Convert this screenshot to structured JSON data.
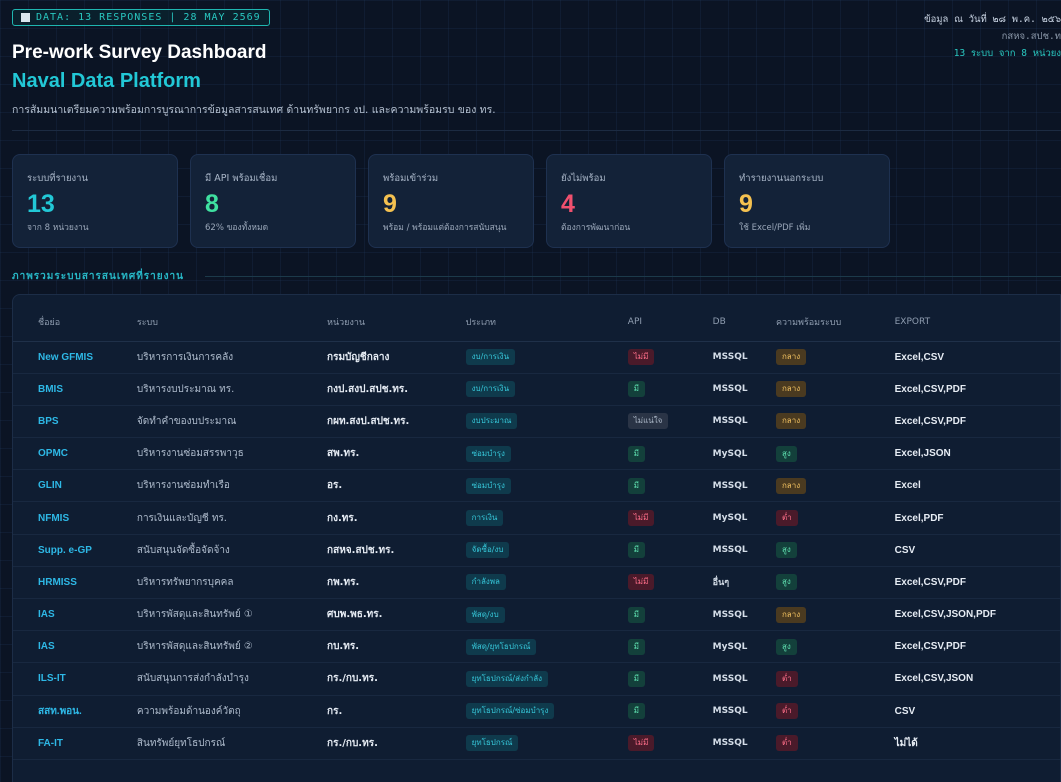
{
  "header": {
    "badge": "DATA: 13 RESPONSES | 28 MAY 2569",
    "title": "Pre-work Survey Dashboard",
    "subtitle_brand": "Naval Data Platform",
    "description": "การสัมมนาเตรียมความพร้อมการบูรณาการข้อมูลสารสนเทศ ด้านทรัพยากร งป. และความพร้อมรบ ของ ทร.",
    "right_line1": "ข้อมูล ณ วันที่ ๒๘ พ.ค. ๒๕๖",
    "right_line2": "กสหจ.สปช.ท",
    "right_line3": "13 ระบบ จาก 8 หน่วยง"
  },
  "cards": [
    {
      "label": "ระบบที่รายงาน",
      "value": "13",
      "sub": "จาก 8 หน่วยงาน",
      "color": "#22c8d6"
    },
    {
      "label": "มี API พร้อมเชื่อม",
      "value": "8",
      "sub": "62% ของทั้งหมด",
      "color": "#3fe0a0"
    },
    {
      "label": "พร้อมเข้าร่วม",
      "value": "9",
      "sub": "พร้อม / พร้อมแต่ต้องการสนับสนุน",
      "color": "#f4c150"
    },
    {
      "label": "ยังไม่พร้อม",
      "value": "4",
      "sub": "ต้องการพัฒนาก่อน",
      "color": "#f0506e"
    },
    {
      "label": "ทำรายงานนอกระบบ",
      "value": "9",
      "sub": "ใช้ Excel/PDF เพิ่ม",
      "color": "#f4c150"
    }
  ],
  "section": {
    "title": "ภาพรวมระบบสารสนเทศที่รายงาน"
  },
  "table": {
    "headers": [
      "ชื่อย่อ",
      "ระบบ",
      "หน่วยงาน",
      "ประเภท",
      "API",
      "DB",
      "ความพร้อมระบบ",
      "EXPORT"
    ],
    "rows": [
      {
        "short": "New GFMIS",
        "system": "บริหารการเงินการคลัง",
        "unit": "กรมบัญชีกลาง",
        "type": "งบ/การเงิน",
        "api": "ไม่มี",
        "db": "MSSQL",
        "ready": "กลาง",
        "export": "Excel,CSV"
      },
      {
        "short": "BMIS",
        "system": "บริหารงบประมาณ ทร.",
        "unit": "กงป.สงป.สปช.ทร.",
        "type": "งบ/การเงิน",
        "api": "มี",
        "db": "MSSQL",
        "ready": "กลาง",
        "export": "Excel,CSV,PDF"
      },
      {
        "short": "BPS",
        "system": "จัดทำคำของบประมาณ",
        "unit": "กผท.สงป.สปช.ทร.",
        "type": "งบประมาณ",
        "api": "ไม่แน่ใจ",
        "db": "MSSQL",
        "ready": "กลาง",
        "export": "Excel,CSV,PDF"
      },
      {
        "short": "OPMC",
        "system": "บริหารงานซ่อมสรรพาวุธ",
        "unit": "สพ.ทร.",
        "type": "ซ่อมบำรุง",
        "api": "มี",
        "db": "MySQL",
        "ready": "สูง",
        "export": "Excel,JSON"
      },
      {
        "short": "GLIN",
        "system": "บริหารงานซ่อมทำเรือ",
        "unit": "อร.",
        "type": "ซ่อมบำรุง",
        "api": "มี",
        "db": "MSSQL",
        "ready": "กลาง",
        "export": "Excel"
      },
      {
        "short": "NFMIS",
        "system": "การเงินและบัญชี ทร.",
        "unit": "กง.ทร.",
        "type": "การเงิน",
        "api": "ไม่มี",
        "db": "MySQL",
        "ready": "ต่ำ",
        "export": "Excel,PDF"
      },
      {
        "short": "Supp. e-GP",
        "system": "สนับสนุนจัดซื้อจัดจ้าง",
        "unit": "กสหจ.สปช.ทร.",
        "type": "จัดซื้อ/งบ",
        "api": "มี",
        "db": "MSSQL",
        "ready": "สูง",
        "export": "CSV"
      },
      {
        "short": "HRMISS",
        "system": "บริหารทรัพยากรบุคคล",
        "unit": "กพ.ทร.",
        "type": "กำลังพล",
        "api": "ไม่มี",
        "db": "อื่นๆ",
        "ready": "สูง",
        "export": "Excel,CSV,PDF"
      },
      {
        "short": "IAS",
        "system": "บริหารพัสดุและสินทรัพย์ ①",
        "unit": "ศบพ.พธ.ทร.",
        "type": "พัสดุ/งบ",
        "api": "มี",
        "db": "MSSQL",
        "ready": "กลาง",
        "export": "Excel,CSV,JSON,PDF"
      },
      {
        "short": "IAS",
        "system": "บริหารพัสดุและสินทรัพย์ ②",
        "unit": "กบ.ทร.",
        "type": "พัสดุ/ยุทโธปกรณ์",
        "api": "มี",
        "db": "MySQL",
        "ready": "สูง",
        "export": "Excel,CSV,PDF"
      },
      {
        "short": "ILS-IT",
        "system": "สนับสนุนการส่งกำลังบำรุง",
        "unit": "กร./กบ.ทร.",
        "type": "ยุทโธปกรณ์/ส่งกำลัง",
        "api": "มี",
        "db": "MSSQL",
        "ready": "ต่ำ",
        "export": "Excel,CSV,JSON"
      },
      {
        "short": "สสท.พอน.",
        "system": "ความพร้อมด้านองค์วัตถุ",
        "unit": "กร.",
        "type": "ยุทโธปกรณ์/ซ่อมบำรุง",
        "api": "มี",
        "db": "MSSQL",
        "ready": "ต่ำ",
        "export": "CSV"
      },
      {
        "short": "FA-IT",
        "system": "สินทรัพย์ยุทโธปกรณ์",
        "unit": "กร./กบ.ทร.",
        "type": "ยุทโธปกรณ์",
        "api": "ไม่มี",
        "db": "MSSQL",
        "ready": "ต่ำ",
        "export": "ไม่ได้"
      }
    ]
  }
}
